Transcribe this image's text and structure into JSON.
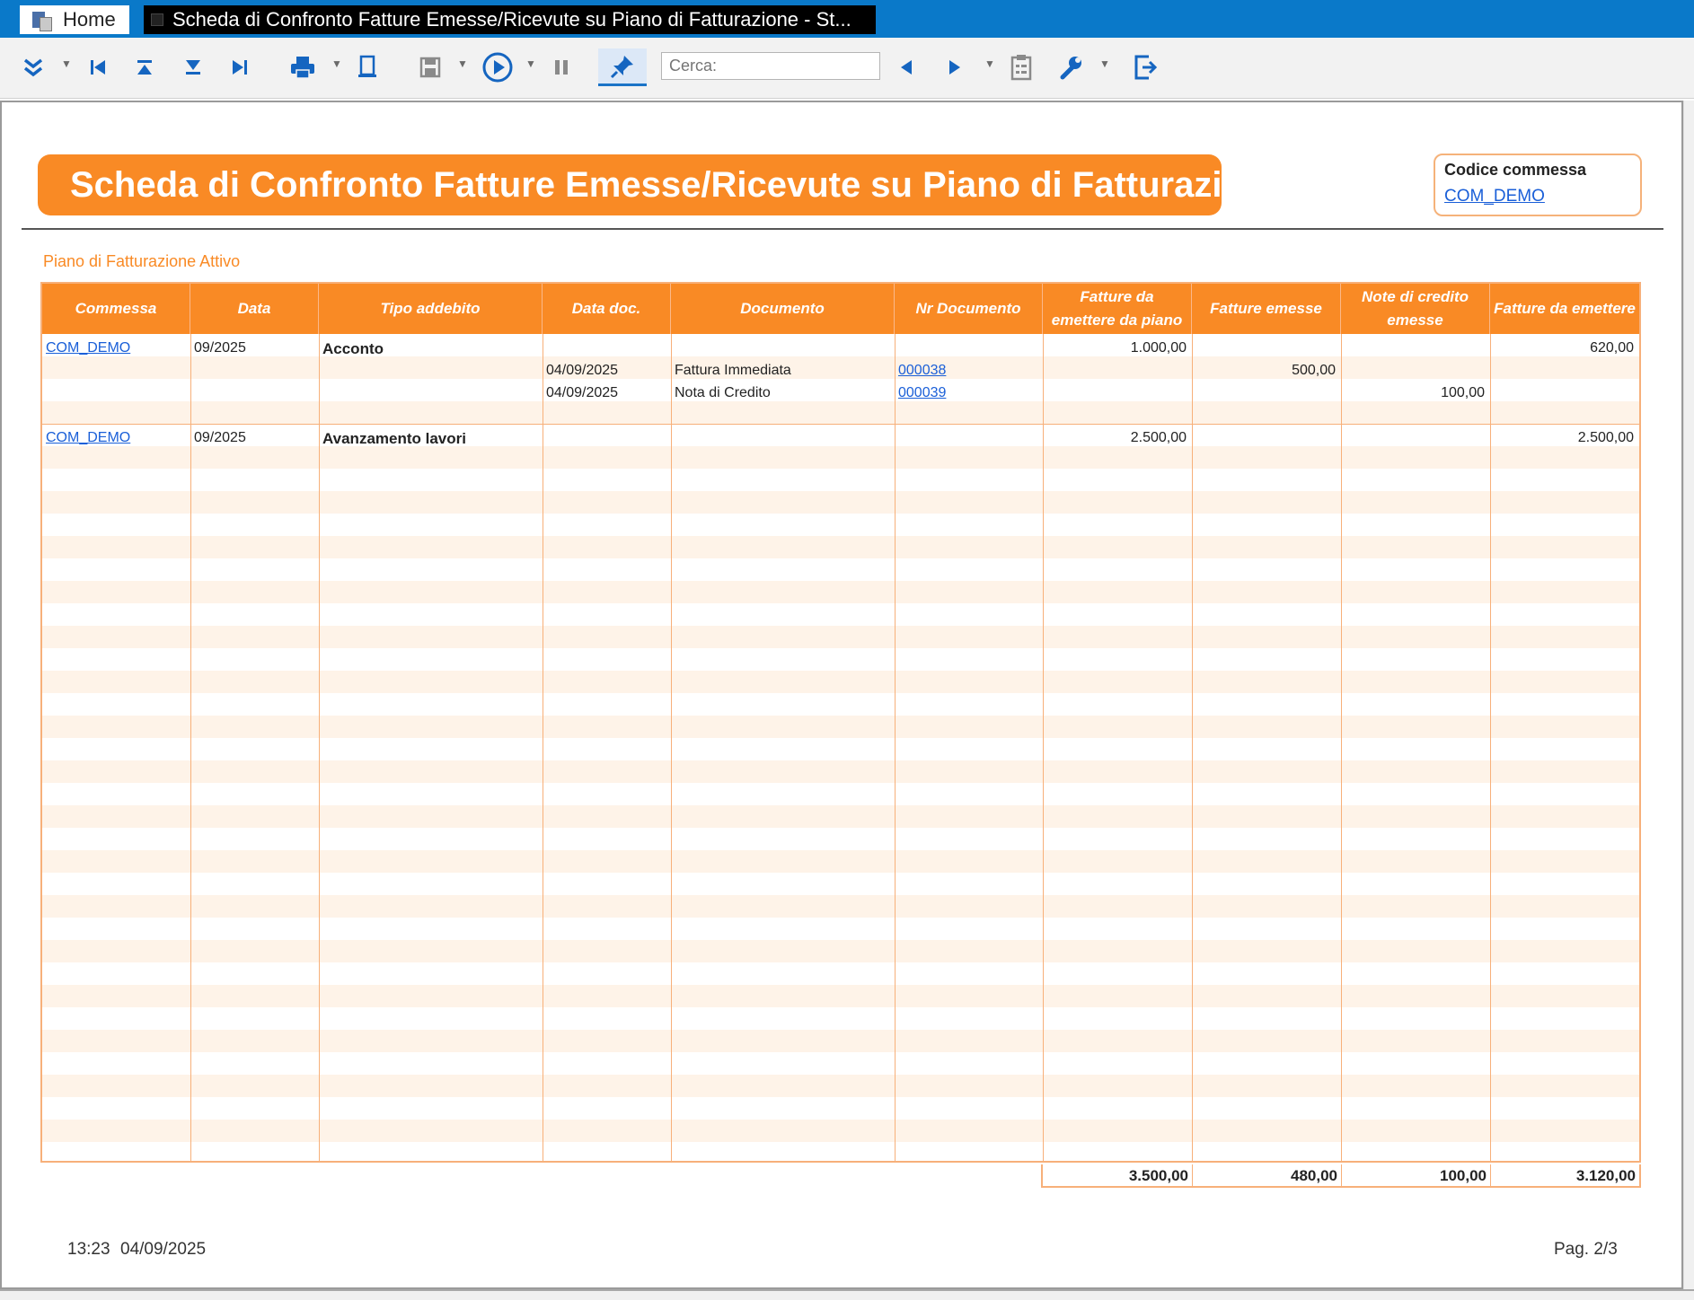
{
  "tabs": {
    "home": "Home",
    "report": "Scheda di Confronto Fatture Emesse/Ricevute su Piano di Fatturazione - St..."
  },
  "toolbar": {
    "search_placeholder": "Cerca:"
  },
  "report": {
    "title": "Scheda di Confronto Fatture Emesse/Ricevute su Piano di Fatturazione",
    "codice_label": "Codice commessa",
    "codice_value": "COM_DEMO",
    "section": "Piano di Fatturazione Attivo",
    "headers": {
      "commessa": "Commessa",
      "data": "Data",
      "tipo": "Tipo addebito",
      "data_doc": "Data doc.",
      "documento": "Documento",
      "nr_doc": "Nr Documento",
      "da_piano": "Fatture da emettere da piano",
      "emesse": "Fatture emesse",
      "note_credito": "Note di credito emesse",
      "da_emettere": "Fatture da emettere"
    },
    "rows": [
      {
        "commessa": "COM_DEMO",
        "data": "09/2025",
        "tipo": "Acconto",
        "da_piano": "1.000,00",
        "da_emettere": "620,00",
        "docs": [
          {
            "data_doc": "04/09/2025",
            "documento": "Fattura Immediata",
            "nr": "000038",
            "emesse": "500,00",
            "note_credito": ""
          },
          {
            "data_doc": "04/09/2025",
            "documento": "Nota di Credito",
            "nr": "000039",
            "emesse": "",
            "note_credito": "100,00"
          }
        ]
      },
      {
        "commessa": "COM_DEMO",
        "data": "09/2025",
        "tipo": "Avanzamento lavori",
        "da_piano": "2.500,00",
        "da_emettere": "2.500,00"
      }
    ],
    "totals": {
      "da_piano": "3.500,00",
      "emesse": "480,00",
      "note_credito": "100,00",
      "da_emettere": "3.120,00"
    },
    "footer": {
      "time": "13:23",
      "date": "04/09/2025",
      "page": "Pag. 2/3"
    }
  },
  "colors": {
    "accent": "#f98a25",
    "titlebar": "#0a79c9",
    "link": "#1a5fd8"
  }
}
